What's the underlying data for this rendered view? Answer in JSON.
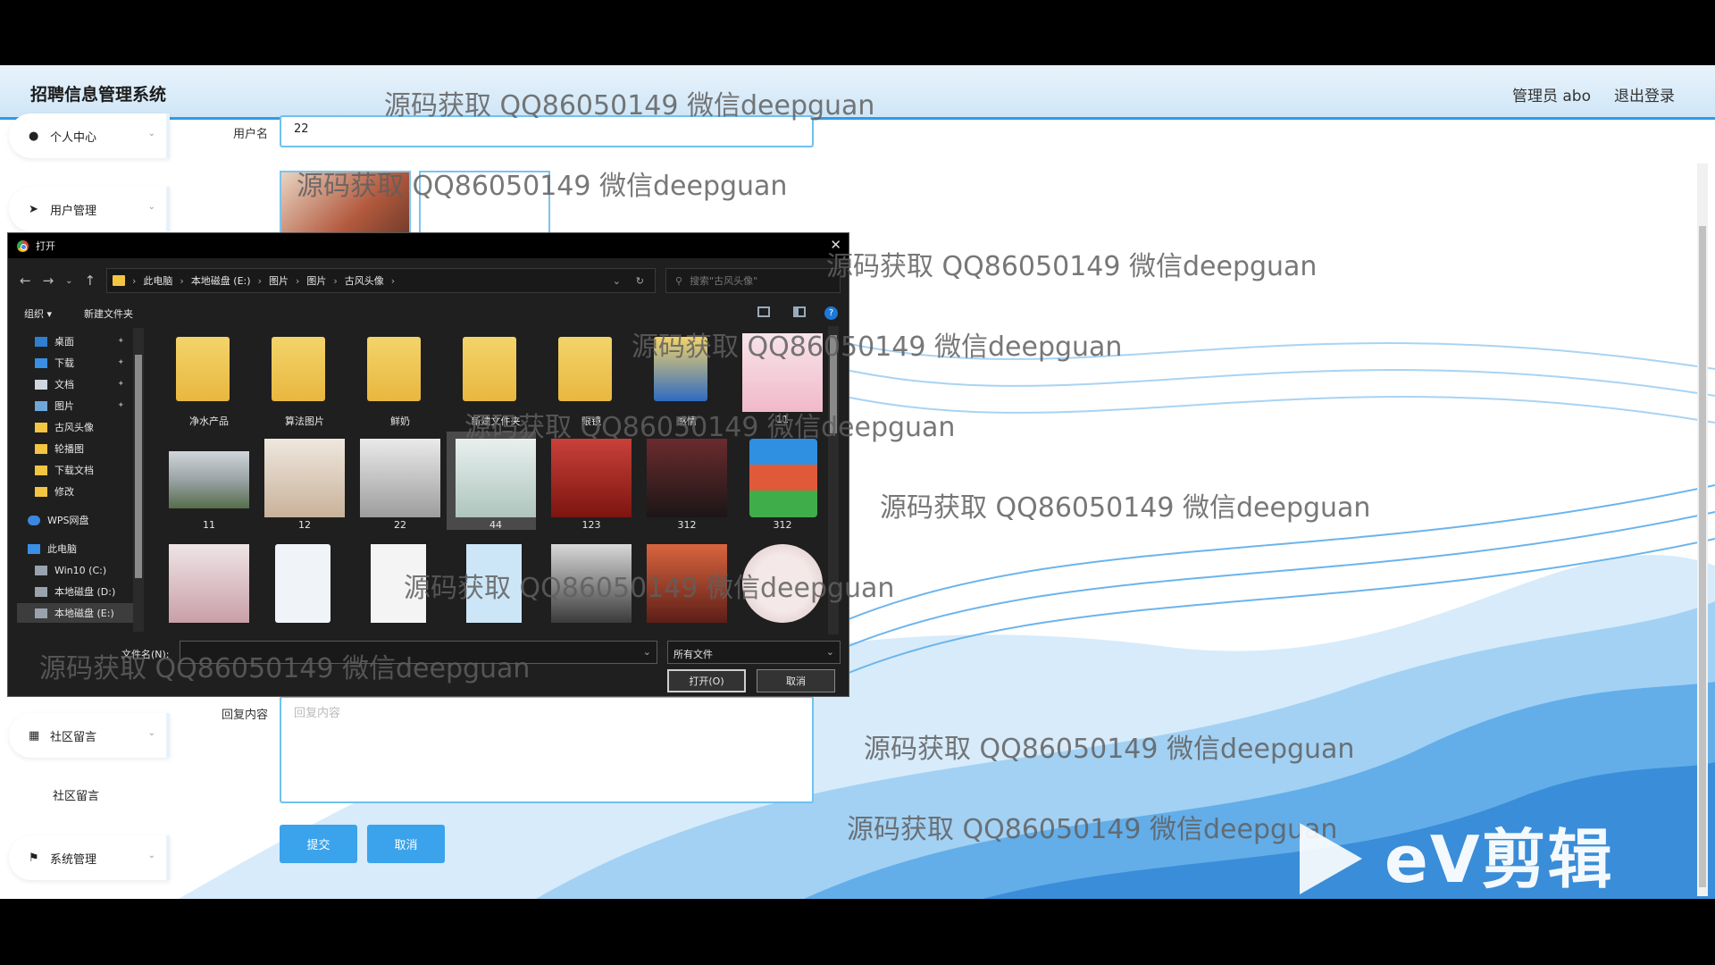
{
  "app": {
    "title": "招聘信息管理系统",
    "user": "管理员 abo",
    "logout": "退出登录"
  },
  "sidebar": {
    "items": [
      {
        "label": "个人中心"
      },
      {
        "label": "用户管理"
      },
      {
        "label": "社区留言"
      },
      {
        "label": "系统管理"
      }
    ],
    "sub_label": "社区留言"
  },
  "form": {
    "username_label": "用户名",
    "username_value": "22",
    "reply_label": "回复内容",
    "reply_placeholder": "回复内容",
    "submit": "提交",
    "cancel": "取消"
  },
  "dialog": {
    "title": "打开",
    "path": [
      "此电脑",
      "本地磁盘 (E:)",
      "图片",
      "图片",
      "古风头像"
    ],
    "search_placeholder": "搜索\"古风头像\"",
    "organize": "组织 ▾",
    "new_folder": "新建文件夹",
    "nav": [
      {
        "label": "桌面"
      },
      {
        "label": "下载"
      },
      {
        "label": "文档"
      },
      {
        "label": "图片"
      },
      {
        "label": "古风头像"
      },
      {
        "label": "轮播图"
      },
      {
        "label": "下载文档"
      },
      {
        "label": "修改"
      },
      {
        "label": "WPS网盘"
      },
      {
        "label": "此电脑"
      },
      {
        "label": "Win10 (C:)"
      },
      {
        "label": "本地磁盘 (D:)"
      },
      {
        "label": "本地磁盘 (E:)"
      }
    ],
    "files_row1": [
      "净水产品",
      "算法图片",
      "鲜奶",
      "新建文件夹",
      "眼镜",
      "感情",
      "11"
    ],
    "files_row2": [
      "11",
      "12",
      "22",
      "44",
      "123",
      "312",
      "312"
    ],
    "filename_label": "文件名(N):",
    "filetype": "所有文件",
    "open_btn": "打开(O)",
    "cancel_btn": "取消"
  },
  "watermark": "源码获取 QQ86050149 微信deepguan",
  "ev_logo": "eV剪辑",
  "colors": {
    "accent": "#3aa3ec",
    "header_border": "#2f9be6",
    "dialog_bg": "#1f1f1f"
  }
}
